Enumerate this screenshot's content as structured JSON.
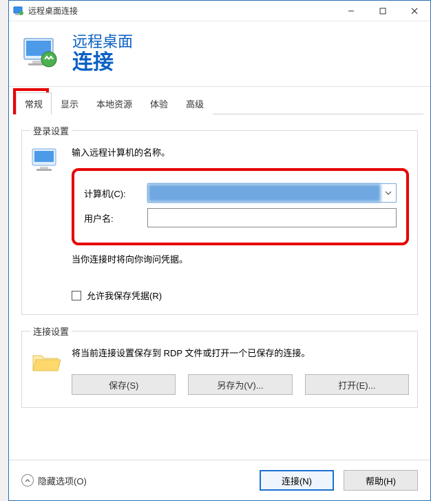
{
  "window": {
    "title": "远程桌面连接"
  },
  "header": {
    "line1": "远程桌面",
    "line2": "连接"
  },
  "tabs": {
    "items": [
      {
        "label": "常规",
        "active": true
      },
      {
        "label": "显示",
        "active": false
      },
      {
        "label": "本地资源",
        "active": false
      },
      {
        "label": "体验",
        "active": false
      },
      {
        "label": "高级",
        "active": false
      }
    ]
  },
  "login": {
    "legend": "登录设置",
    "intro": "输入远程计算机的名称。",
    "computer_label": "计算机(C):",
    "computer_value": "",
    "username_label": "用户名:",
    "username_value": "",
    "hint": "当你连接时将向你询问凭据。",
    "save_creds_label": "允许我保存凭据(R)",
    "save_creds_checked": false
  },
  "connection": {
    "legend": "连接设置",
    "text": "将当前连接设置保存到 RDP 文件或打开一个已保存的连接。",
    "save_label": "保存(S)",
    "save_as_label": "另存为(V)...",
    "open_label": "打开(E)..."
  },
  "footer": {
    "hide_options_label": "隐藏选项(O)",
    "connect_label": "连接(N)",
    "help_label": "帮助(H)"
  }
}
